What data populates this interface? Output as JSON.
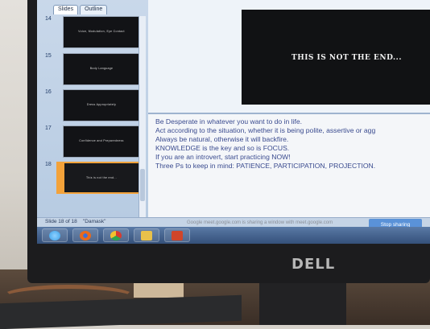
{
  "panel": {
    "tabs": [
      {
        "label": "Slides",
        "active": true
      },
      {
        "label": "Outline",
        "active": false
      }
    ],
    "slides": [
      {
        "num": "14",
        "thumb_text": "Voice, Modulation, Eye Contact"
      },
      {
        "num": "15",
        "thumb_text": "Body Language"
      },
      {
        "num": "16",
        "thumb_text": "Dress Appropriately"
      },
      {
        "num": "17",
        "thumb_text": "Confidence and Preparedness"
      },
      {
        "num": "18",
        "thumb_text": "This is not the end...",
        "selected": true
      }
    ]
  },
  "slide": {
    "title": "THIS IS NOT THE END..."
  },
  "notes": {
    "lines": [
      "Be Desperate in whatever you want to do in life.",
      "Act according to the situation, whether it is being polite, assertive or agg",
      "Always be natural, otherwise it will backfire.",
      "KNOWLEDGE is the key and so is FOCUS.",
      "If you are an introvert, start practicing NOW!",
      "Three Ps to keep in mind: PATIENCE, PARTICIPATION, PROJECTION."
    ]
  },
  "status_bar": {
    "slide_info": "Slide 18 of 18",
    "theme": "\"Damask\""
  },
  "share_bar": {
    "message": "Google meet.google.com is sharing a window with meet.google.com",
    "stop_label": "Stop sharing"
  },
  "taskbar": {
    "apps": [
      {
        "name": "windows-start-icon",
        "color": "#3aa0e8"
      },
      {
        "name": "firefox-icon",
        "color": "#e86a1c"
      },
      {
        "name": "chrome-icon",
        "color": "#2fa44f"
      },
      {
        "name": "folder-icon",
        "color": "#e8c14a"
      },
      {
        "name": "powerpoint-icon",
        "color": "#d0452a"
      }
    ]
  },
  "monitor": {
    "brand": "DELL"
  },
  "colors": {
    "accent_selected": "#f3a23a",
    "notes_text": "#3a4b8f",
    "stop_button": "#5a92d8"
  }
}
